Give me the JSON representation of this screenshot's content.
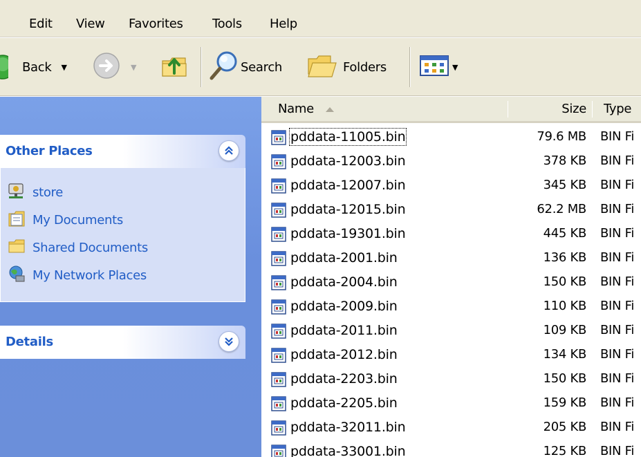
{
  "menu": [
    "Edit",
    "View",
    "Favorites",
    "Tools",
    "Help"
  ],
  "toolbar": {
    "back_label": "Back",
    "search_label": "Search",
    "folders_label": "Folders"
  },
  "taskpane": {
    "other_places": {
      "title": "Other Places",
      "items": [
        {
          "label": "store",
          "icon": "network-drive-icon"
        },
        {
          "label": "My Documents",
          "icon": "my-documents-icon"
        },
        {
          "label": "Shared Documents",
          "icon": "folder-icon"
        },
        {
          "label": "My Network Places",
          "icon": "network-places-icon"
        }
      ]
    },
    "details": {
      "title": "Details"
    }
  },
  "filelist": {
    "columns": {
      "name": "Name",
      "size": "Size",
      "type": "Type"
    },
    "rows": [
      {
        "name": "pddata-11005.bin",
        "size": "79.6 MB",
        "type": "BIN Fi"
      },
      {
        "name": "pddata-12003.bin",
        "size": "378 KB",
        "type": "BIN Fi"
      },
      {
        "name": "pddata-12007.bin",
        "size": "345 KB",
        "type": "BIN Fi"
      },
      {
        "name": "pddata-12015.bin",
        "size": "62.2 MB",
        "type": "BIN Fi"
      },
      {
        "name": "pddata-19301.bin",
        "size": "445 KB",
        "type": "BIN Fi"
      },
      {
        "name": "pddata-2001.bin",
        "size": "136 KB",
        "type": "BIN Fi"
      },
      {
        "name": "pddata-2004.bin",
        "size": "150 KB",
        "type": "BIN Fi"
      },
      {
        "name": "pddata-2009.bin",
        "size": "110 KB",
        "type": "BIN Fi"
      },
      {
        "name": "pddata-2011.bin",
        "size": "109 KB",
        "type": "BIN Fi"
      },
      {
        "name": "pddata-2012.bin",
        "size": "134 KB",
        "type": "BIN Fi"
      },
      {
        "name": "pddata-2203.bin",
        "size": "150 KB",
        "type": "BIN Fi"
      },
      {
        "name": "pddata-2205.bin",
        "size": "159 KB",
        "type": "BIN Fi"
      },
      {
        "name": "pddata-32011.bin",
        "size": "205 KB",
        "type": "BIN Fi"
      },
      {
        "name": "pddata-33001.bin",
        "size": "125 KB",
        "type": "BIN Fi"
      }
    ]
  },
  "colors": {
    "link_blue": "#215dc6",
    "pane_blue": "#6b8fda",
    "chrome": "#ece9d8"
  }
}
